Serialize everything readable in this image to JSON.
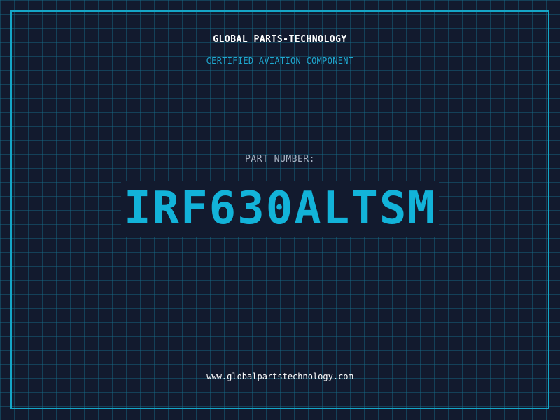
{
  "header": {
    "company": "GLOBAL PARTS-TECHNOLOGY",
    "subtitle": "CERTIFIED AVIATION COMPONENT"
  },
  "main": {
    "part_label": "PART NUMBER:",
    "part_number": "IRF630ALTSM"
  },
  "footer": {
    "website": "www.globalpartstechnology.com"
  },
  "colors": {
    "background": "#121a2e",
    "grid": "#166e8c",
    "accent": "#15a6c8",
    "part_number": "#12b3d9",
    "label": "#aab4c4",
    "text": "#ffffff"
  }
}
